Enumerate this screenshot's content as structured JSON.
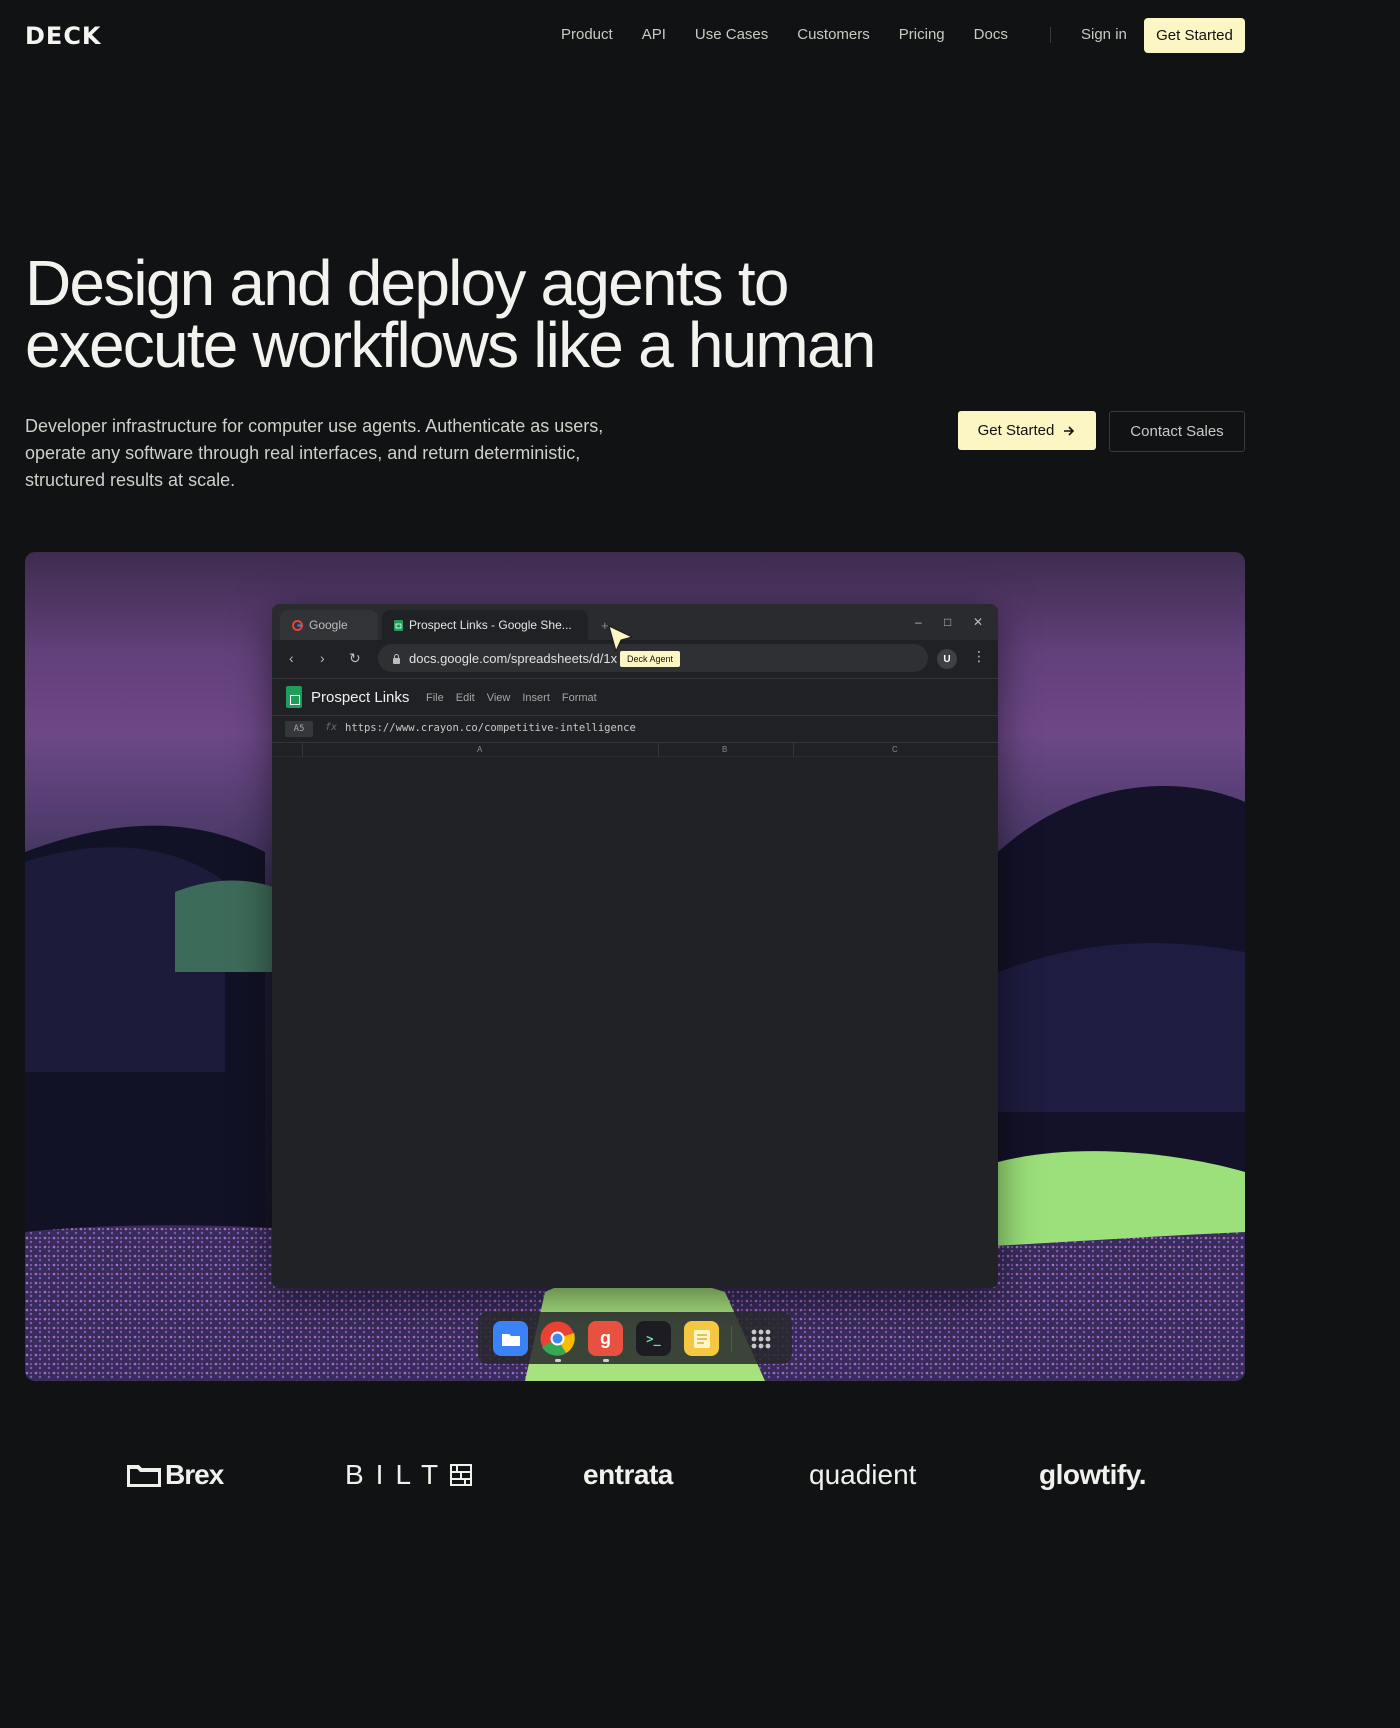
{
  "nav": {
    "logo": "DECK",
    "links": [
      "Product",
      "API",
      "Use Cases",
      "Customers",
      "Pricing",
      "Docs"
    ],
    "signin": "Sign in",
    "cta": "Get Started"
  },
  "hero": {
    "title_line1": "Design and deploy agents to",
    "title_line2": "execute workflows like a human",
    "subtitle": "Developer infrastructure for computer use agents. Authenticate as users, operate any software through real interfaces, and return deterministic, structured results at scale.",
    "primary_cta": "Get Started",
    "primary_cta_icon": "arrow-right-icon",
    "secondary_cta": "Contact Sales"
  },
  "browser": {
    "tabs": [
      {
        "label": "Google",
        "icon": "google-icon"
      },
      {
        "label": "Prospect Links - Google She...",
        "icon": "sheets-icon"
      }
    ],
    "new_tab": "+",
    "url": "docs.google.com/spreadsheets/d/1x",
    "avatar": "U",
    "sheet_title": "Prospect Links",
    "sheet_menu": [
      "File",
      "Edit",
      "View",
      "Insert",
      "Format"
    ],
    "cell_ref": "A5",
    "fx": "fx",
    "formula": "https://www.crayon.co/competitive-intelligence",
    "columns": [
      "A",
      "B",
      "C"
    ],
    "agent_label": "Deck Agent"
  },
  "dock": {
    "apps": [
      "files-icon",
      "chrome-icon",
      "g-app-icon",
      "terminal-icon",
      "notes-icon",
      "app-grid-icon"
    ],
    "g_letter": "g",
    "terminal_glyph": ">_"
  },
  "customers": [
    "Brex",
    "BILT",
    "entrata",
    "quadient",
    "glowtify."
  ],
  "colors": {
    "accent": "#fbf6c4",
    "background": "#111213"
  }
}
